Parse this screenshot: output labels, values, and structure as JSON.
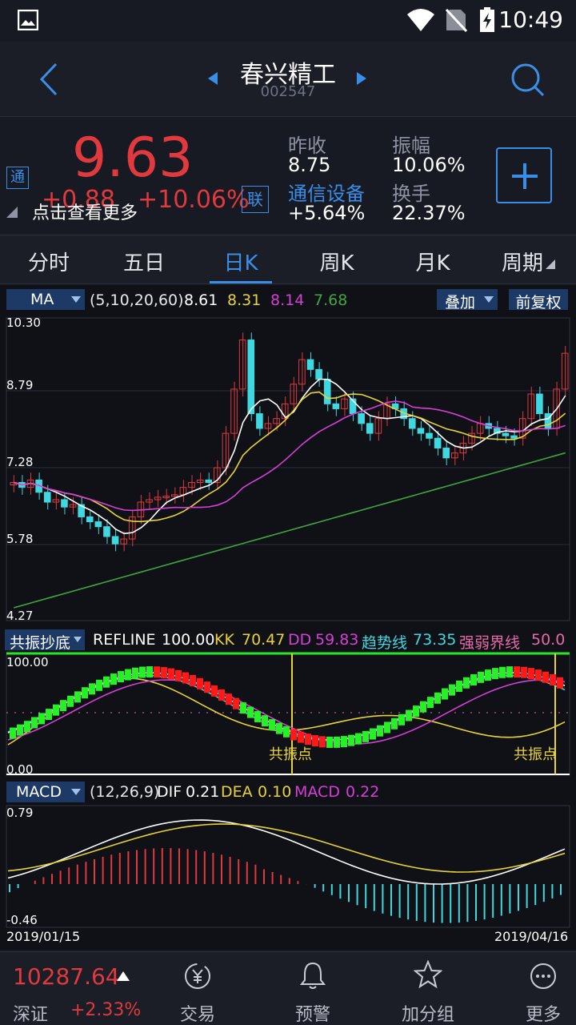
{
  "status": {
    "time": "10:49"
  },
  "header": {
    "name": "春兴精工",
    "code": "002547"
  },
  "quote": {
    "price": "9.63",
    "change": "+0.88",
    "change_pct": "+10.06%",
    "tong_badge": "通",
    "lian_badge": "联",
    "hint": "点击查看更多",
    "prev_close_label": "昨收",
    "prev_close": "8.75",
    "amplitude_label": "振幅",
    "amplitude": "10.06%",
    "sector_label": "通信设备",
    "sector_change": "+5.64%",
    "turnover_label": "换手",
    "turnover": "22.37%"
  },
  "tabs": [
    {
      "label": "分时"
    },
    {
      "label": "五日"
    },
    {
      "label": "日K"
    },
    {
      "label": "周K"
    },
    {
      "label": "月K"
    },
    {
      "label": "周期"
    }
  ],
  "ma_bar": {
    "select": "MA",
    "params": "(5,10,20,60)",
    "v1": "8.61",
    "v2": "8.31",
    "v3": "8.14",
    "v4": "7.68",
    "overlay": "叠加",
    "adjust": "前复权"
  },
  "price_axis": [
    "10.30",
    "8.79",
    "7.28",
    "5.78",
    "4.27"
  ],
  "resonance_bar": {
    "select": "共振抄底",
    "refline_label": "REFLINE",
    "refline": "100.00",
    "kk_label": "KK",
    "kk": "70.47",
    "dd_label": "DD",
    "dd": "59.83",
    "trend_label": "趋势线",
    "trend": "73.35",
    "strength_label": "强弱界线",
    "strength": "50.0",
    "axis_top": "100.00",
    "axis_bottom": "0.00",
    "marker": "共振点"
  },
  "macd_bar": {
    "select": "MACD",
    "params": "(12,26,9)",
    "dif_label": "DIF",
    "dif": "0.21",
    "dea_label": "DEA",
    "dea": "0.10",
    "macd_label": "MACD",
    "macd": "0.22",
    "axis_top": "0.79",
    "axis_bottom": "-0.46"
  },
  "dates": {
    "start": "2019/01/15",
    "end": "2019/04/16"
  },
  "bottom": {
    "index_value": "10287.64",
    "index_name": "深证",
    "index_change": "+2.33%",
    "nav": [
      {
        "label": "交易",
        "icon": "yen-cycle-icon"
      },
      {
        "label": "预警",
        "icon": "bell-icon"
      },
      {
        "label": "加分组",
        "icon": "star-icon"
      },
      {
        "label": "更多",
        "icon": "more-icon"
      }
    ]
  },
  "colors": {
    "up": "#e0393e",
    "down": "#3fd8e0",
    "accent": "#3b8ee8",
    "ma5": "#ffffff",
    "ma10": "#e8d23a",
    "ma20": "#d63fd6",
    "ma60": "#3fa63f"
  }
}
